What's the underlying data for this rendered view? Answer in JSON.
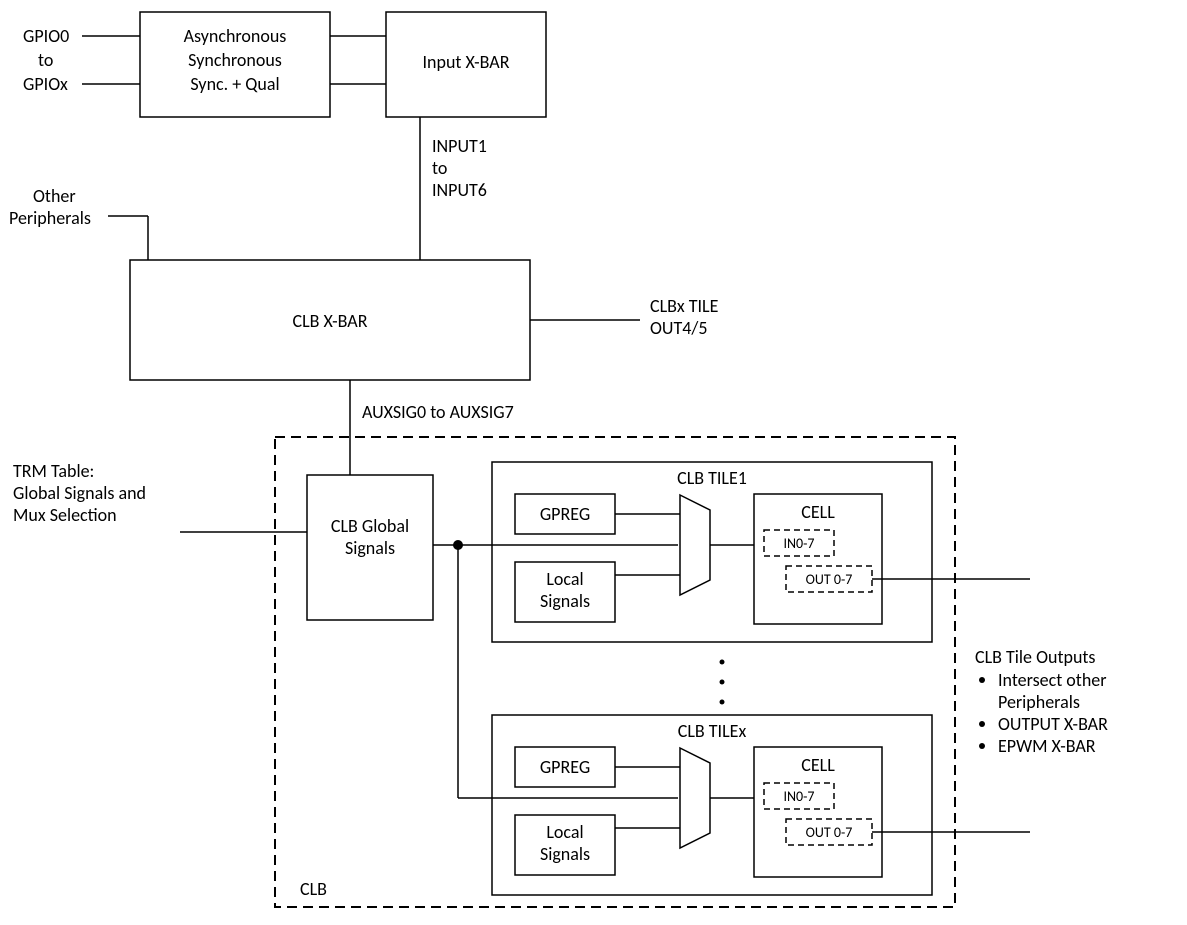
{
  "gpio": {
    "top": "GPIO0",
    "mid": "to",
    "bot": "GPIOx"
  },
  "async_block": {
    "l1": "Asynchronous",
    "l2": "Synchronous",
    "l3": "Sync. + Qual"
  },
  "input_xbar": "Input X-BAR",
  "input_bus": {
    "l1": "INPUT1",
    "l2": "to",
    "l3": "INPUT6"
  },
  "other_periph": {
    "l1": "Other",
    "l2": "Peripherals"
  },
  "clb_xbar": "CLB X-BAR",
  "clbx_tile_out": {
    "l1": "CLBx TILE",
    "l2": "OUT4/5"
  },
  "auxsig": "AUXSIG0 to AUXSIG7",
  "trm": {
    "l1": "TRM Table:",
    "l2": "Global Signals and",
    "l3": "Mux Selection"
  },
  "clb_global": {
    "l1": "CLB Global",
    "l2": "Signals"
  },
  "clb_label": "CLB",
  "tile1": {
    "title": "CLB TILE1",
    "gpreg": "GPREG",
    "local": {
      "l1": "Local",
      "l2": "Signals"
    },
    "cell": "CELL",
    "in": "IN0-7",
    "out": "OUT 0-7"
  },
  "tilex": {
    "title": "CLB TILEx",
    "gpreg": "GPREG",
    "local": {
      "l1": "Local",
      "l2": "Signals"
    },
    "cell": "CELL",
    "in": "IN0-7",
    "out": "OUT 0-7"
  },
  "outputs": {
    "title": "CLB Tile Outputs",
    "b1a": "Intersect other",
    "b1b": "Peripherals",
    "b2": "OUTPUT X-BAR",
    "b3": "EPWM X-BAR"
  }
}
